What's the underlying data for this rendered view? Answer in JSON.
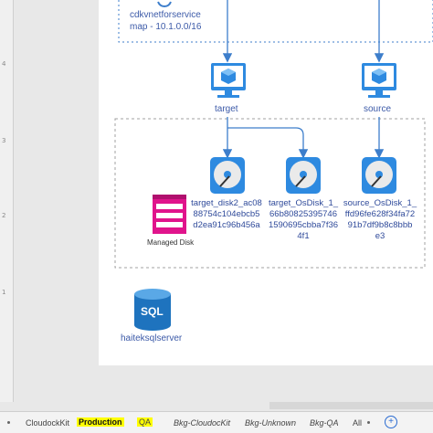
{
  "ruler": {
    "ticks": [
      "4",
      "3",
      "2",
      "1"
    ]
  },
  "vnet": {
    "line1": "cdkvnetforservice",
    "line2": "map - 10.1.0.0/16"
  },
  "vms": [
    {
      "label": "target"
    },
    {
      "label": "source"
    }
  ],
  "disks": [
    {
      "lines": [
        "target_disk2_ac08",
        "88754c104ebcb5",
        "d2ea91c96b456a"
      ]
    },
    {
      "lines": [
        "target_OsDisk_1_",
        "66b80825395746",
        "1590695cbba7f36",
        "4f1"
      ]
    },
    {
      "lines": [
        "source_OsDisk_1_",
        "ffd96fe628f34fa72",
        "91b7df9b8c8bbb",
        "e3"
      ]
    }
  ],
  "managed_disk": {
    "label": "Managed Disk"
  },
  "sql": {
    "icon_text": "SQL",
    "label": "haiteksqlserver"
  },
  "tabs": [
    {
      "label": "CloudockKit"
    },
    {
      "label": "Production"
    },
    {
      "label": "QA"
    },
    {
      "label": "Bkg-CloudocKit"
    },
    {
      "label": "Bkg-Unknown"
    },
    {
      "label": "Bkg-QA"
    },
    {
      "label": "All"
    }
  ],
  "colors": {
    "accent": "#3d7ecb",
    "icon_blue": "#2e8ae0",
    "managed_disk": "#e0148c",
    "sql": "#1e73be",
    "highlight": "#ffff00"
  }
}
